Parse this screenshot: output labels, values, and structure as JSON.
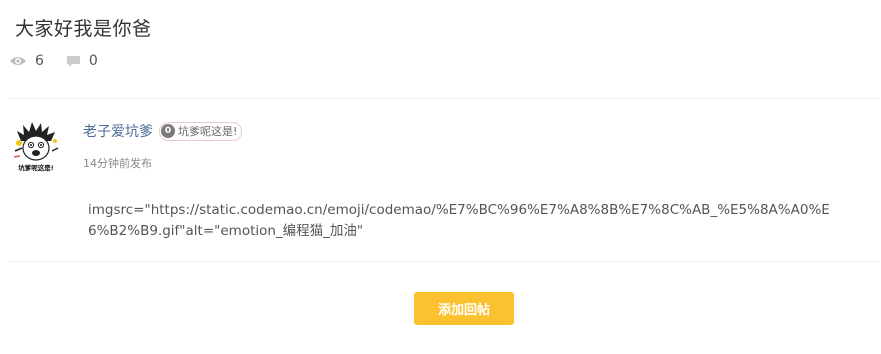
{
  "post": {
    "title": "大家好我是你爸",
    "views": "6",
    "comments": "0",
    "view_icon": "eye-icon",
    "comment_icon": "comment-icon"
  },
  "reply": {
    "author": "老子爱坑爹",
    "badge_level": "0",
    "badge_text": "坑爹呢这是!",
    "time": "14分钟前发布",
    "content": "imgsrc=\"https://static.codemao.cn/emoji/codemao/%E7%BC%96%E7%A8%8B%E7%8C%AB_%E5%8A%A0%E6%B2%B9.gif\"alt=\"emotion_编程猫_加油\"",
    "avatar_caption": "坑爹呢这是!"
  },
  "actions": {
    "add_reply_label": "添加回帖"
  },
  "colors": {
    "accent": "#fcc12f",
    "link": "#4a6b9a"
  }
}
